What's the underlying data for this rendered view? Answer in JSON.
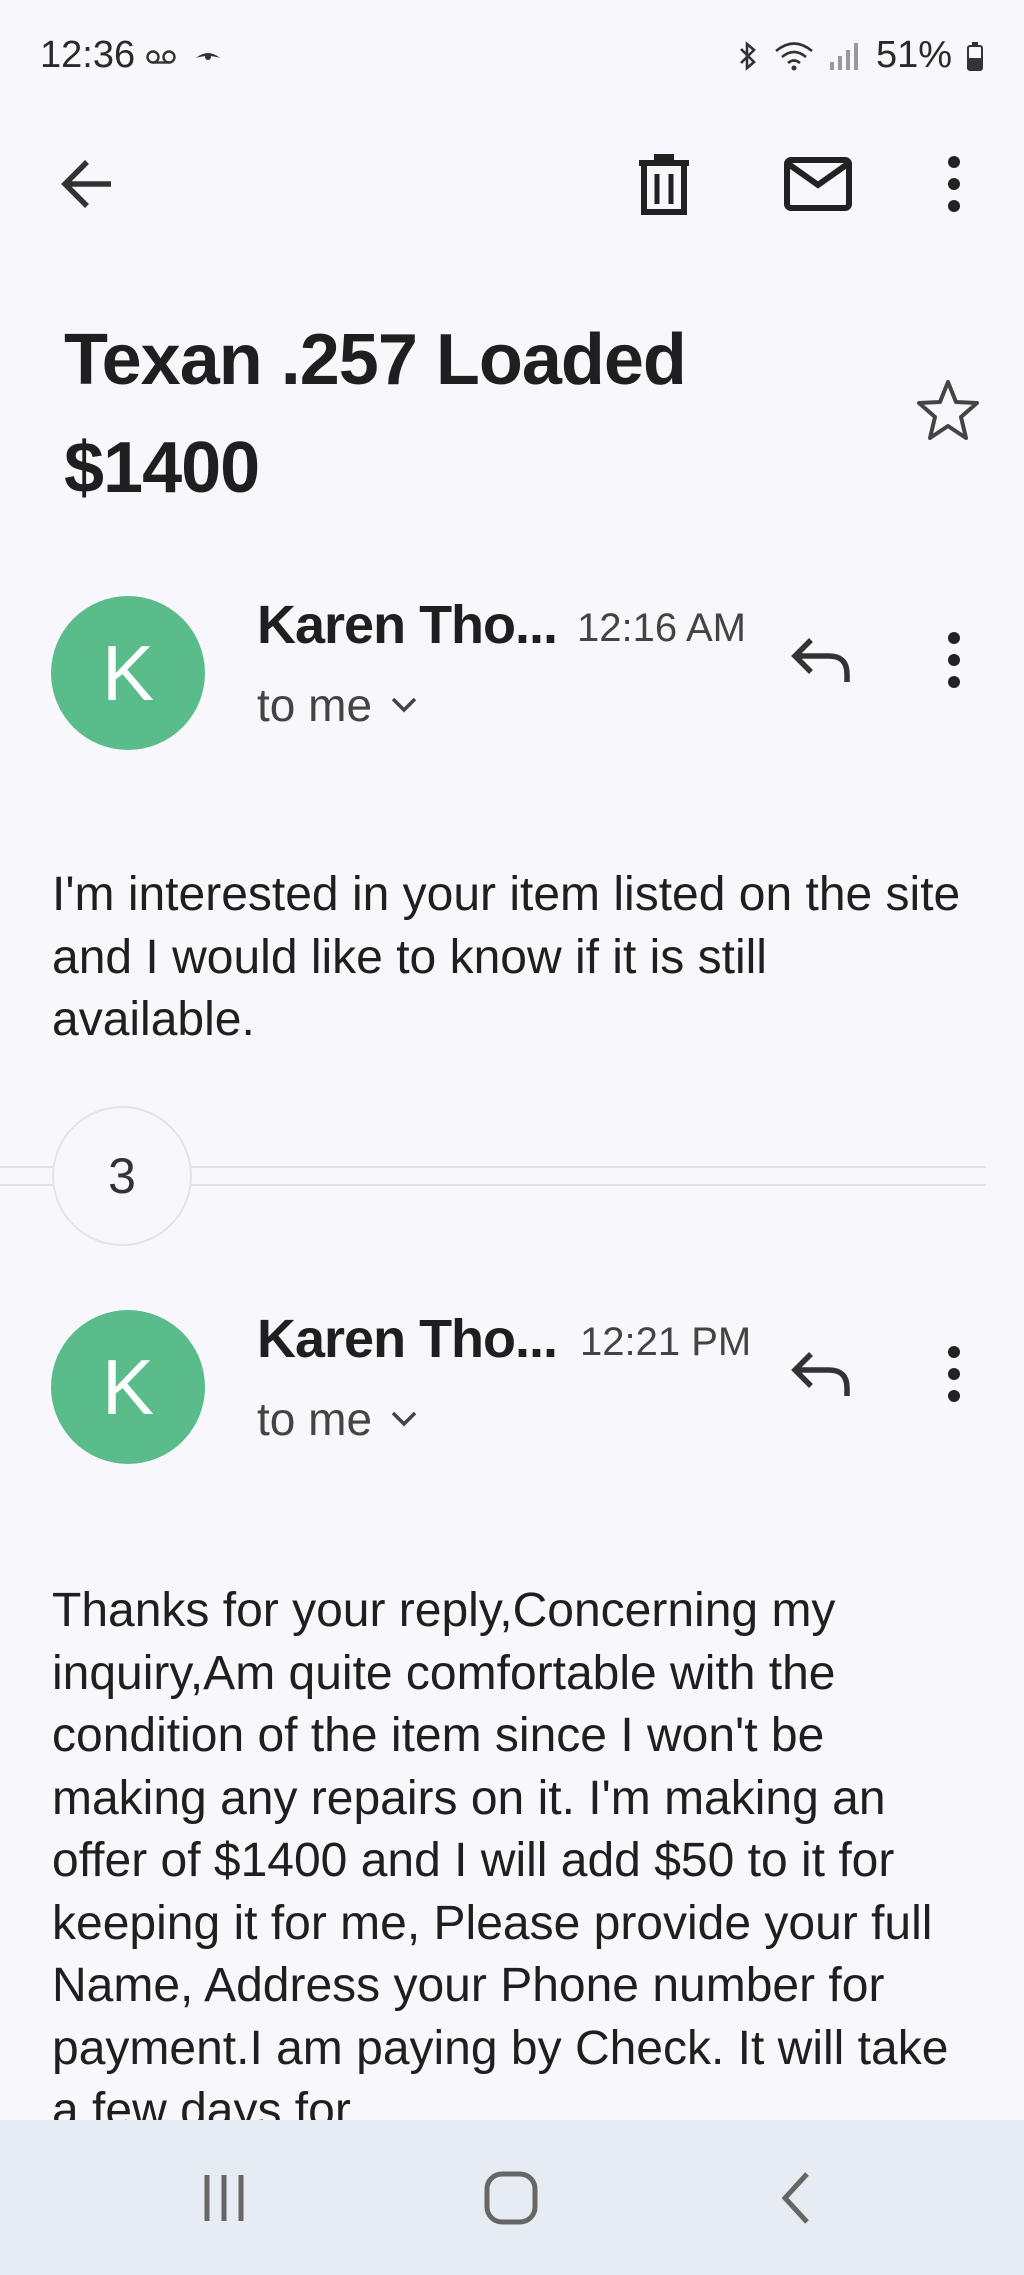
{
  "status_bar": {
    "time": "12:36",
    "battery": "51%"
  },
  "toolbar": {
    "back": "back-arrow",
    "delete": "trash-icon",
    "mark_unread": "mail-icon",
    "more": "more-vert-icon"
  },
  "subject": {
    "line1": "Texan .257 Loaded",
    "line2": "$1400"
  },
  "messages": [
    {
      "avatar_letter": "K",
      "sender": "Karen Tho...",
      "time": "12:16 AM",
      "recipient": "to me",
      "body": "I'm interested in your item listed on the site and I would like to know if it is still available."
    },
    {
      "avatar_letter": "K",
      "sender": "Karen Tho...",
      "time": "12:21 PM",
      "recipient": "to me",
      "body": "Thanks for your reply,Concerning my inquiry,Am quite comfortable with the condition of the item since I won't be making any repairs on it. I'm making an offer of $1400 and I will add $50 to it for keeping it for me, Please provide your full Name, Address your Phone number for payment.I am paying by Check. It will take a few days for"
    }
  ],
  "collapsed_count": "3",
  "colors": {
    "avatar": "#5bbc8b",
    "background": "#f8f8fc",
    "navbar": "#e7ecf2"
  }
}
